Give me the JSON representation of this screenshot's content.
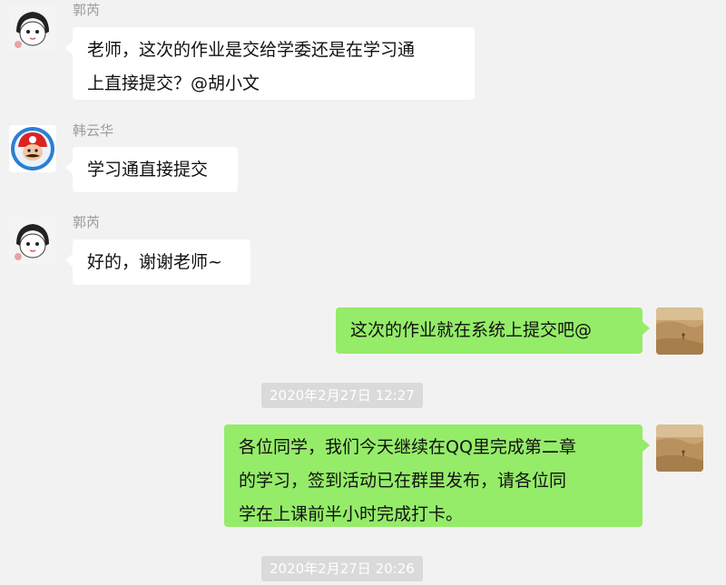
{
  "messages": [
    {
      "sender": "郭芮",
      "lines": [
        "老师，这次的作业是交给学委还是在学习通",
        "上直接提交？@胡小文"
      ],
      "avatar_icon": "cartoon-girl-avatar-icon"
    },
    {
      "sender": "韩云华",
      "lines": [
        "学习通直接提交"
      ],
      "avatar_icon": "mario-avatar-icon"
    },
    {
      "sender": "郭芮",
      "lines": [
        "好的，谢谢老师~"
      ],
      "avatar_icon": "cartoon-girl-avatar-icon"
    },
    {
      "sender": "",
      "lines": [
        "这次的作业就在系统上提交吧@"
      ],
      "avatar_icon": "desert-landscape-avatar-icon"
    },
    {
      "sender": "",
      "lines": [
        "各位同学，我们今天继续在QQ里完成第二章",
        "的学习，签到活动已在群里发布，请各位同",
        "学在上课前半小时完成打卡。"
      ],
      "avatar_icon": "desert-landscape-avatar-icon"
    }
  ],
  "timestamps": [
    "2020年2月27日 12:27",
    "2020年2月27日 20:26"
  ],
  "colors": {
    "background": "#f2f2f2",
    "incoming_bubble": "#ffffff",
    "outgoing_bubble": "#95ec69",
    "sender_name": "#9b9b9b",
    "timestamp_bg": "#dadada"
  }
}
